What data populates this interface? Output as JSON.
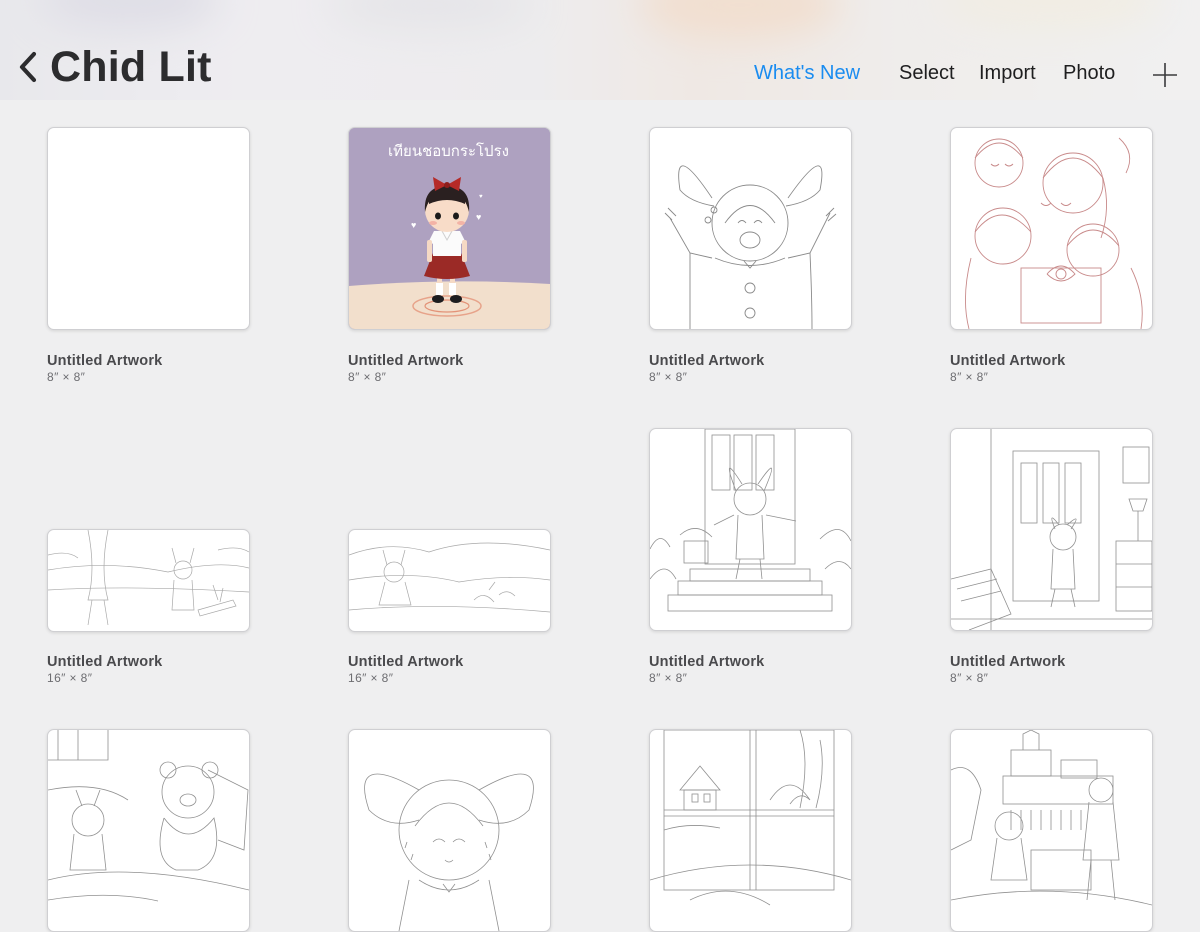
{
  "header": {
    "back_title": "Chid Lit",
    "whats_new": "What's New",
    "select": "Select",
    "import": "Import",
    "photo": "Photo"
  },
  "colors": {
    "accent": "#1a8cf0",
    "background": "#efeff0",
    "purple_canvas": "#aea1c0"
  },
  "artworks": [
    {
      "name": "Untitled Artwork",
      "size": "8″ × 8″",
      "thumb": "blank"
    },
    {
      "name": "Untitled Artwork",
      "size": "8″ × 8″",
      "thumb": "girl-on-purple",
      "caption": "เทียนชอบกระโปรง"
    },
    {
      "name": "Untitled Artwork",
      "size": "8″ × 8″",
      "thumb": "bunny-child-sketch"
    },
    {
      "name": "Untitled Artwork",
      "size": "8″ × 8″",
      "thumb": "group-sketch-red"
    },
    {
      "name": "Untitled Artwork",
      "size": "16″ × 8″",
      "thumb": "landscape-sketch"
    },
    {
      "name": "Untitled Artwork",
      "size": "16″ × 8″",
      "thumb": "landscape-sketch-2"
    },
    {
      "name": "Untitled Artwork",
      "size": "8″ × 8″",
      "thumb": "door-steps-sketch"
    },
    {
      "name": "Untitled Artwork",
      "size": "8″ × 8″",
      "thumb": "room-door-sketch"
    },
    {
      "thumb": "teddy-room-sketch"
    },
    {
      "thumb": "bunny-hood-sketch"
    },
    {
      "thumb": "window-sketch"
    },
    {
      "thumb": "kids-room-sketch"
    }
  ]
}
